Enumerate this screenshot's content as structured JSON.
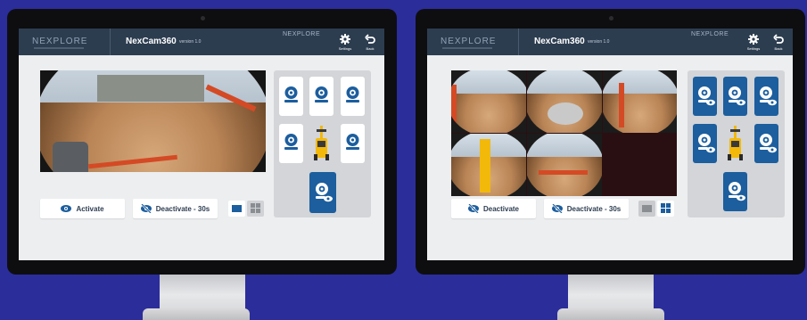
{
  "app": {
    "logo_text": "NEXPLORE",
    "title": "NexCam360",
    "version": "version 1.0",
    "brand_mark": "NEXPLORE",
    "settings_label": "Settings",
    "back_label": "Back"
  },
  "left_screen": {
    "view_mode": "single",
    "activate_label": "Activate",
    "deactivate_label": "Deactivate - 30s",
    "cameras": [
      {
        "position": "front-left",
        "state": "inactive"
      },
      {
        "position": "front",
        "state": "inactive"
      },
      {
        "position": "front-right",
        "state": "inactive"
      },
      {
        "position": "left",
        "state": "inactive"
      },
      {
        "position": "right",
        "state": "inactive"
      },
      {
        "position": "rear",
        "state": "active"
      }
    ]
  },
  "right_screen": {
    "view_mode": "grid",
    "deactivate_label": "Deactivate",
    "deactivate_timed_label": "Deactivate - 30s",
    "cameras": [
      {
        "position": "front-left",
        "state": "active"
      },
      {
        "position": "front",
        "state": "active"
      },
      {
        "position": "front-right",
        "state": "active"
      },
      {
        "position": "left",
        "state": "active"
      },
      {
        "position": "right",
        "state": "active"
      },
      {
        "position": "rear",
        "state": "active"
      }
    ]
  },
  "colors": {
    "background": "#2b2d9a",
    "header": "#2d3d50",
    "accent_blue": "#1c5e9e",
    "machine_yellow": "#f2b90a",
    "panel_gray": "#d3d5d8"
  },
  "icons": [
    "gear-icon",
    "back-arrow-icon",
    "eye-icon",
    "eye-slash-icon",
    "camera-icon",
    "single-view-icon",
    "grid-view-icon",
    "forklift-icon"
  ]
}
